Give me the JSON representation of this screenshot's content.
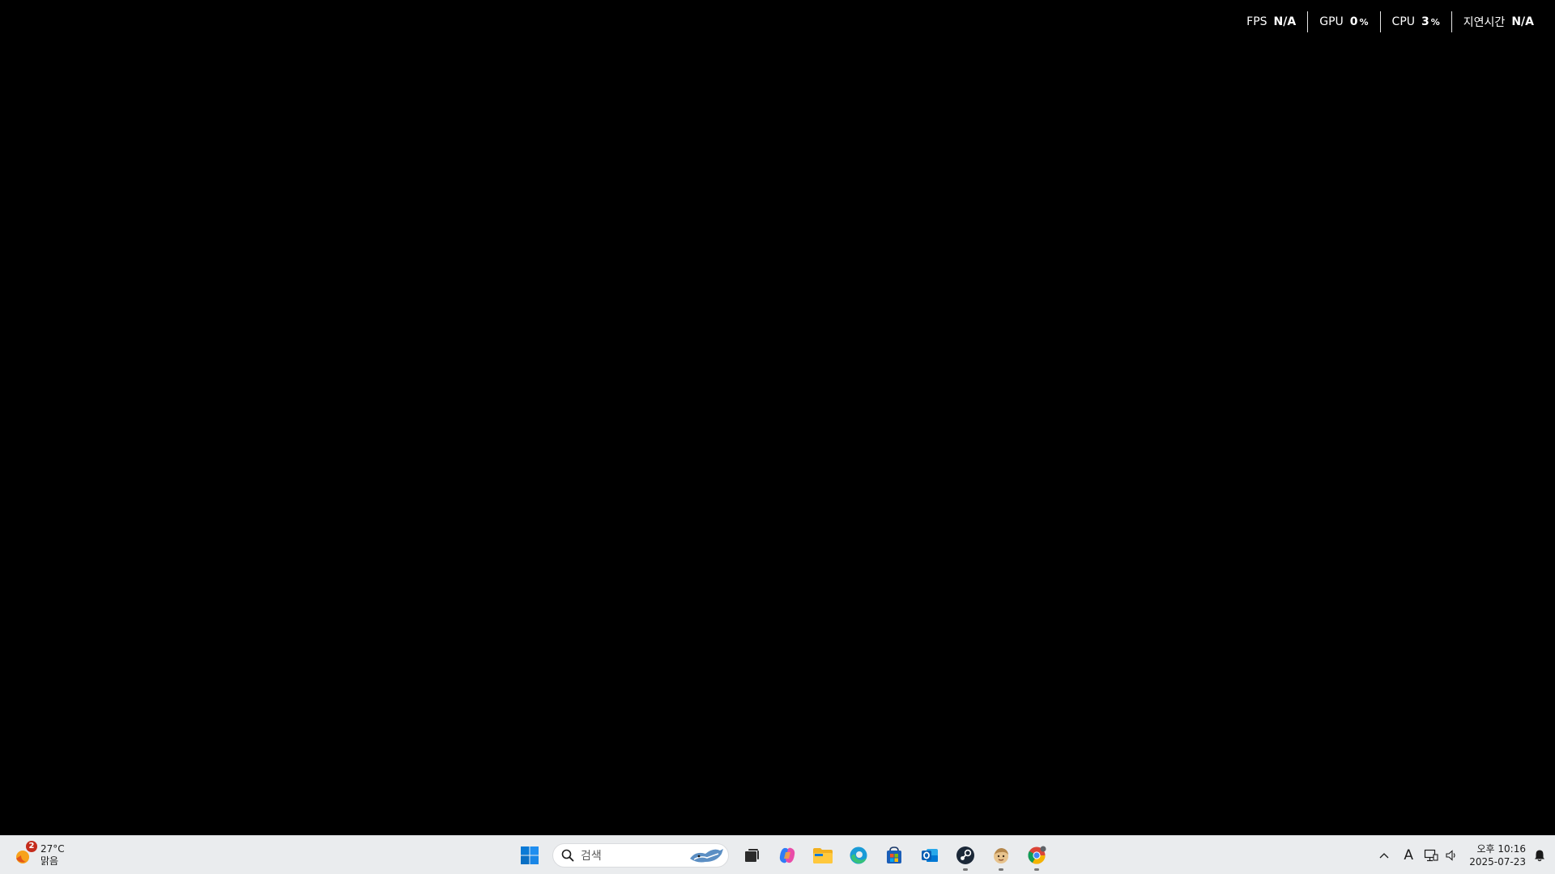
{
  "perf_overlay": {
    "metrics": [
      {
        "label": "FPS",
        "value": "N/A",
        "unit": ""
      },
      {
        "label": "GPU",
        "value": "0",
        "unit": "%"
      },
      {
        "label": "CPU",
        "value": "3",
        "unit": "%"
      },
      {
        "label": "지연시간",
        "value": "N/A",
        "unit": ""
      }
    ]
  },
  "taskbar": {
    "weather": {
      "temperature": "27°C",
      "condition": "맑음",
      "badge_count": "2",
      "icon": "sun-cloud-icon"
    },
    "search": {
      "placeholder": "검색"
    },
    "apps": [
      {
        "name": "start",
        "icon": "windows-logo-icon"
      },
      {
        "name": "task-view",
        "icon": "task-view-icon"
      },
      {
        "name": "copilot",
        "icon": "copilot-icon"
      },
      {
        "name": "file-explorer",
        "icon": "folder-icon"
      },
      {
        "name": "edge",
        "icon": "edge-icon"
      },
      {
        "name": "store",
        "icon": "store-icon"
      },
      {
        "name": "outlook",
        "icon": "outlook-icon"
      },
      {
        "name": "steam",
        "icon": "steam-icon",
        "running": true
      },
      {
        "name": "app-character",
        "icon": "character-icon",
        "running": true
      },
      {
        "name": "chrome",
        "icon": "chrome-icon",
        "running": true
      }
    ],
    "tray": {
      "ime_indicator": "A",
      "time": "오후 10:16",
      "date": "2025-07-23"
    }
  },
  "colors": {
    "desktop": "#000000",
    "taskbar": "#eaecee",
    "windows_blue": "#0078d4",
    "badge_red": "#c42b1c"
  }
}
